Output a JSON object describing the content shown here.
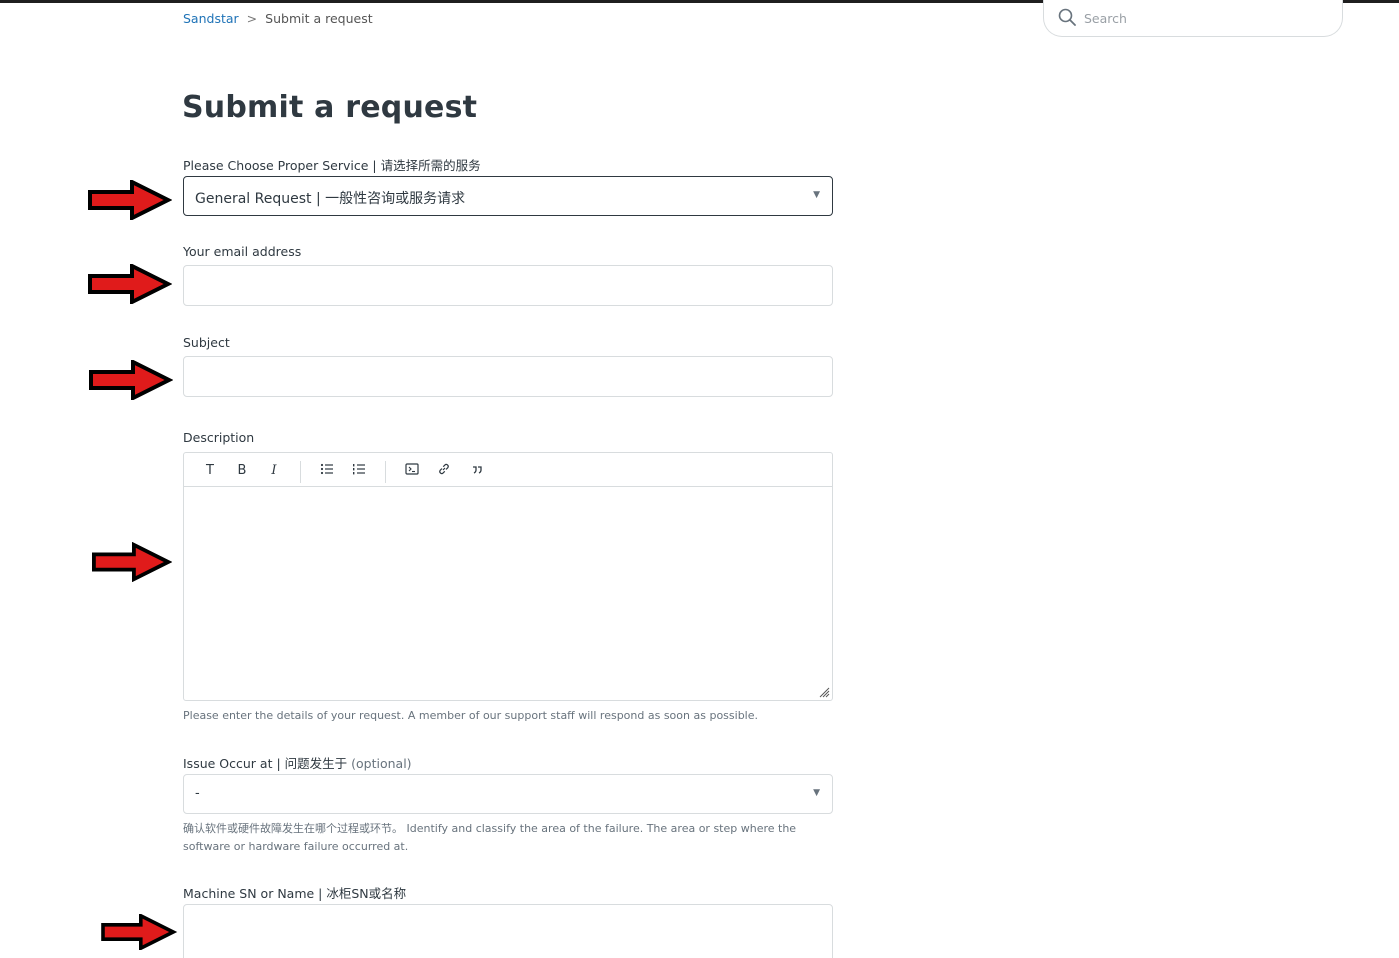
{
  "breadcrumb": {
    "home": "Sandstar",
    "separator": ">",
    "current": "Submit a request"
  },
  "search": {
    "placeholder": "Search"
  },
  "page": {
    "title": "Submit a request"
  },
  "form": {
    "service_label": "Please Choose Proper Service | 请选择所需的服务",
    "service_value": "General Request | 一般性咨询或服务请求",
    "email_label": "Your email address",
    "subject_label": "Subject",
    "description_label": "Description",
    "description_hint": "Please enter the details of your request. A member of our support staff will respond as soon as possible.",
    "issue_label": "Issue Occur at | 问题发生于",
    "issue_optional": "(optional)",
    "issue_value": "-",
    "issue_hint": "确认软件或硬件故障发生在哪个过程或环节。 Identify and classify the area of the failure. The area or step where the software or hardware failure occurred at.",
    "machine_label": "Machine SN or Name | 冰柜SN或名称"
  },
  "toolbar": {
    "text_glyph": "T",
    "bold_glyph": "B",
    "italic_glyph": "I"
  },
  "colors": {
    "link": "#1f73b7",
    "text": "#2f3941",
    "border": "#d8dcde",
    "annotation_arrow": "#e01b1b"
  },
  "icons": [
    "search-icon",
    "dropdown-caret-icon",
    "text-icon",
    "bold-icon",
    "italic-icon",
    "bulleted-list-icon",
    "numbered-list-icon",
    "code-block-icon",
    "link-icon",
    "quote-icon",
    "resize-handle-icon",
    "red-arrow-icon"
  ]
}
